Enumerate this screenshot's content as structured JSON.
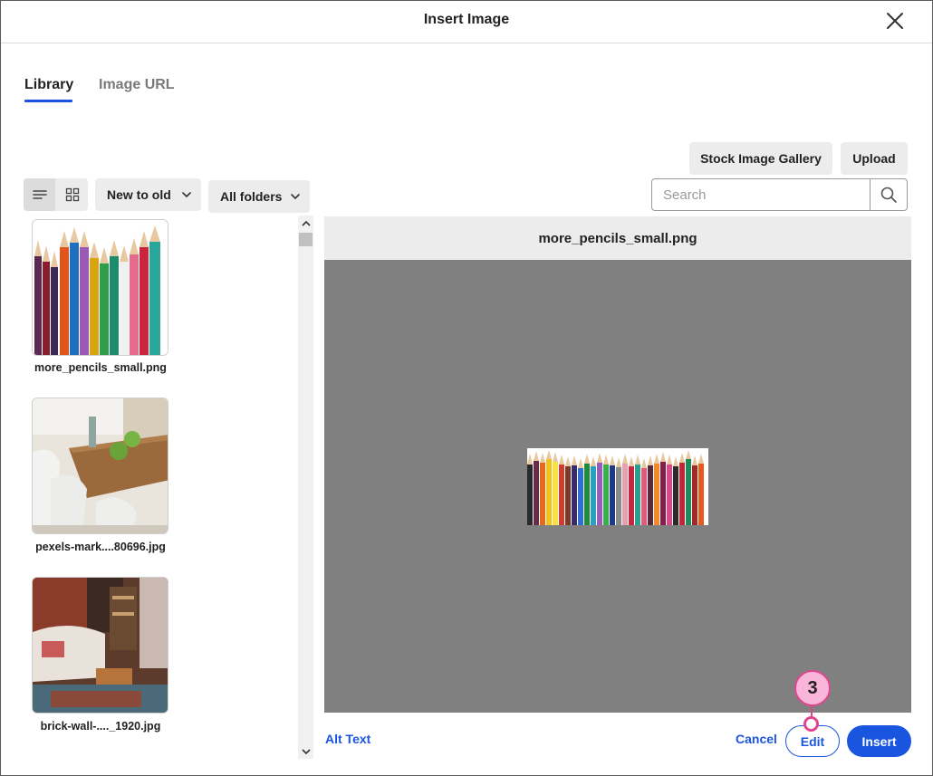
{
  "dialog": {
    "title": "Insert Image",
    "close_icon": "close-icon"
  },
  "tabs": [
    {
      "label": "Library",
      "active": true
    },
    {
      "label": "Image URL",
      "active": false
    }
  ],
  "toolbar": {
    "stock_gallery_label": "Stock Image Gallery",
    "upload_label": "Upload",
    "view_list_icon": "list-view-icon",
    "view_grid_icon": "grid-view-icon",
    "sort_value": "New to old",
    "folder_value": "All folders",
    "search_placeholder": "Search",
    "search_value": ""
  },
  "files": [
    {
      "name": "more_pencils_small.png",
      "icon": "colored-pencils-image"
    },
    {
      "name": "pexels-mark....80696.jpg",
      "icon": "dining-table-image"
    },
    {
      "name": "brick-wall-...._1920.jpg",
      "icon": "living-room-image"
    }
  ],
  "preview": {
    "filename": "more_pencils_small.png"
  },
  "footer": {
    "alt_text_label": "Alt Text",
    "cancel_label": "Cancel",
    "edit_label": "Edit",
    "insert_label": "Insert"
  },
  "annotation": {
    "step_number": "3"
  },
  "colors": {
    "accent": "#1a55e0",
    "badge_fill": "#f9b6da",
    "badge_border": "#e0468e",
    "preview_bg": "#808080"
  }
}
